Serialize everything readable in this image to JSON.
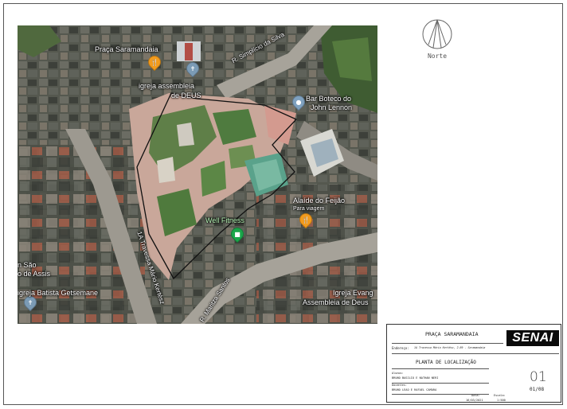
{
  "map": {
    "places": {
      "praca": "Praça Saramandaia",
      "igreja_assembleia_1": "igreja assembleia",
      "igreja_assembleia_2": "de DEUS",
      "bar_1": "Bar Boteco do",
      "bar_2": "John Lennon",
      "alaide_1": "Alaíde do Feijão",
      "alaide_2": "Para viagem",
      "wellfitness": "Well Fitness",
      "sao_1": "n São",
      "sao_2": "o de Assis",
      "batista": "igreja Batista Getsemane",
      "evang_1": "Igreja Evang",
      "evang_2": "Assembleia de Deus"
    },
    "roads": {
      "simplicio": "R. Simplício da Silva",
      "travessa": "1A Travessa Mário Kertész",
      "maritza": "R. Maritza Santos"
    }
  },
  "north": {
    "label": "Norte",
    "icon": "north-arrow-icon"
  },
  "title_block": {
    "project": "PRAÇA SARAMANDAIA",
    "logo": "SENAI",
    "address_label": "Endereço:",
    "address_value": "1A Travessa Mário Kertész, 2-69 - Saramandaia",
    "drawing_title": "PLANTA DE LOCALIZAÇÃO",
    "students_label": "Alunos:",
    "students_value": "BRUNO BASILIO E NATHAN NERI",
    "teachers_label": "Docentes:",
    "teachers_value": "BRUNO LEAO E RAFAEL CAMARA",
    "date_label": "Data:",
    "date_value": "16/03/2021",
    "scale_label": "Escala:",
    "scale_value": "1:500",
    "sheet_big": "01",
    "sheet_of": "01/08"
  },
  "colors": {
    "food_pin": "#f29b1d",
    "religious_pin": "#7b9bb5",
    "fitness_pin": "#1aa64a",
    "bar_pin": "#7fa1bf",
    "logo_bg": "#0b0b0b"
  }
}
